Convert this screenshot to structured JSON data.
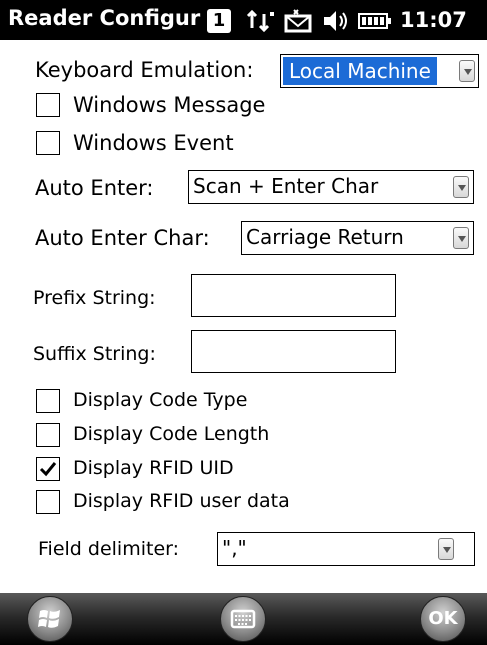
{
  "status_bar": {
    "title": "Reader Configur",
    "notification_count": "1",
    "time": "11:07",
    "icons": [
      "connectivity-icon",
      "message-icon",
      "volume-icon",
      "battery-icon"
    ]
  },
  "form": {
    "keyboard_emulation": {
      "label": "Keyboard Emulation:",
      "value": "Local Machine"
    },
    "windows_message": {
      "label": "Windows Message",
      "checked": false
    },
    "windows_event": {
      "label": "Windows Event",
      "checked": false
    },
    "auto_enter": {
      "label": "Auto Enter:",
      "value": "Scan + Enter Char"
    },
    "auto_enter_char": {
      "label": "Auto Enter Char:",
      "value": "Carriage Return"
    },
    "prefix_string": {
      "label": "Prefix String:",
      "value": ""
    },
    "suffix_string": {
      "label": "Suffix String:",
      "value": ""
    },
    "display_code_type": {
      "label": "Display Code Type",
      "checked": false
    },
    "display_code_length": {
      "label": "Display Code Length",
      "checked": false
    },
    "display_rfid_uid": {
      "label": "Display RFID UID",
      "checked": true
    },
    "display_rfid_user_data": {
      "label": "Display RFID user data",
      "checked": false
    },
    "field_delimiter": {
      "label": "Field delimiter:",
      "value": "\",\""
    }
  },
  "softkeys": {
    "start": "windows-start-icon",
    "keyboard": "keyboard-icon",
    "ok_label": "OK"
  },
  "colors": {
    "selection": "#1c6bd6",
    "title_bar": "#000000"
  }
}
